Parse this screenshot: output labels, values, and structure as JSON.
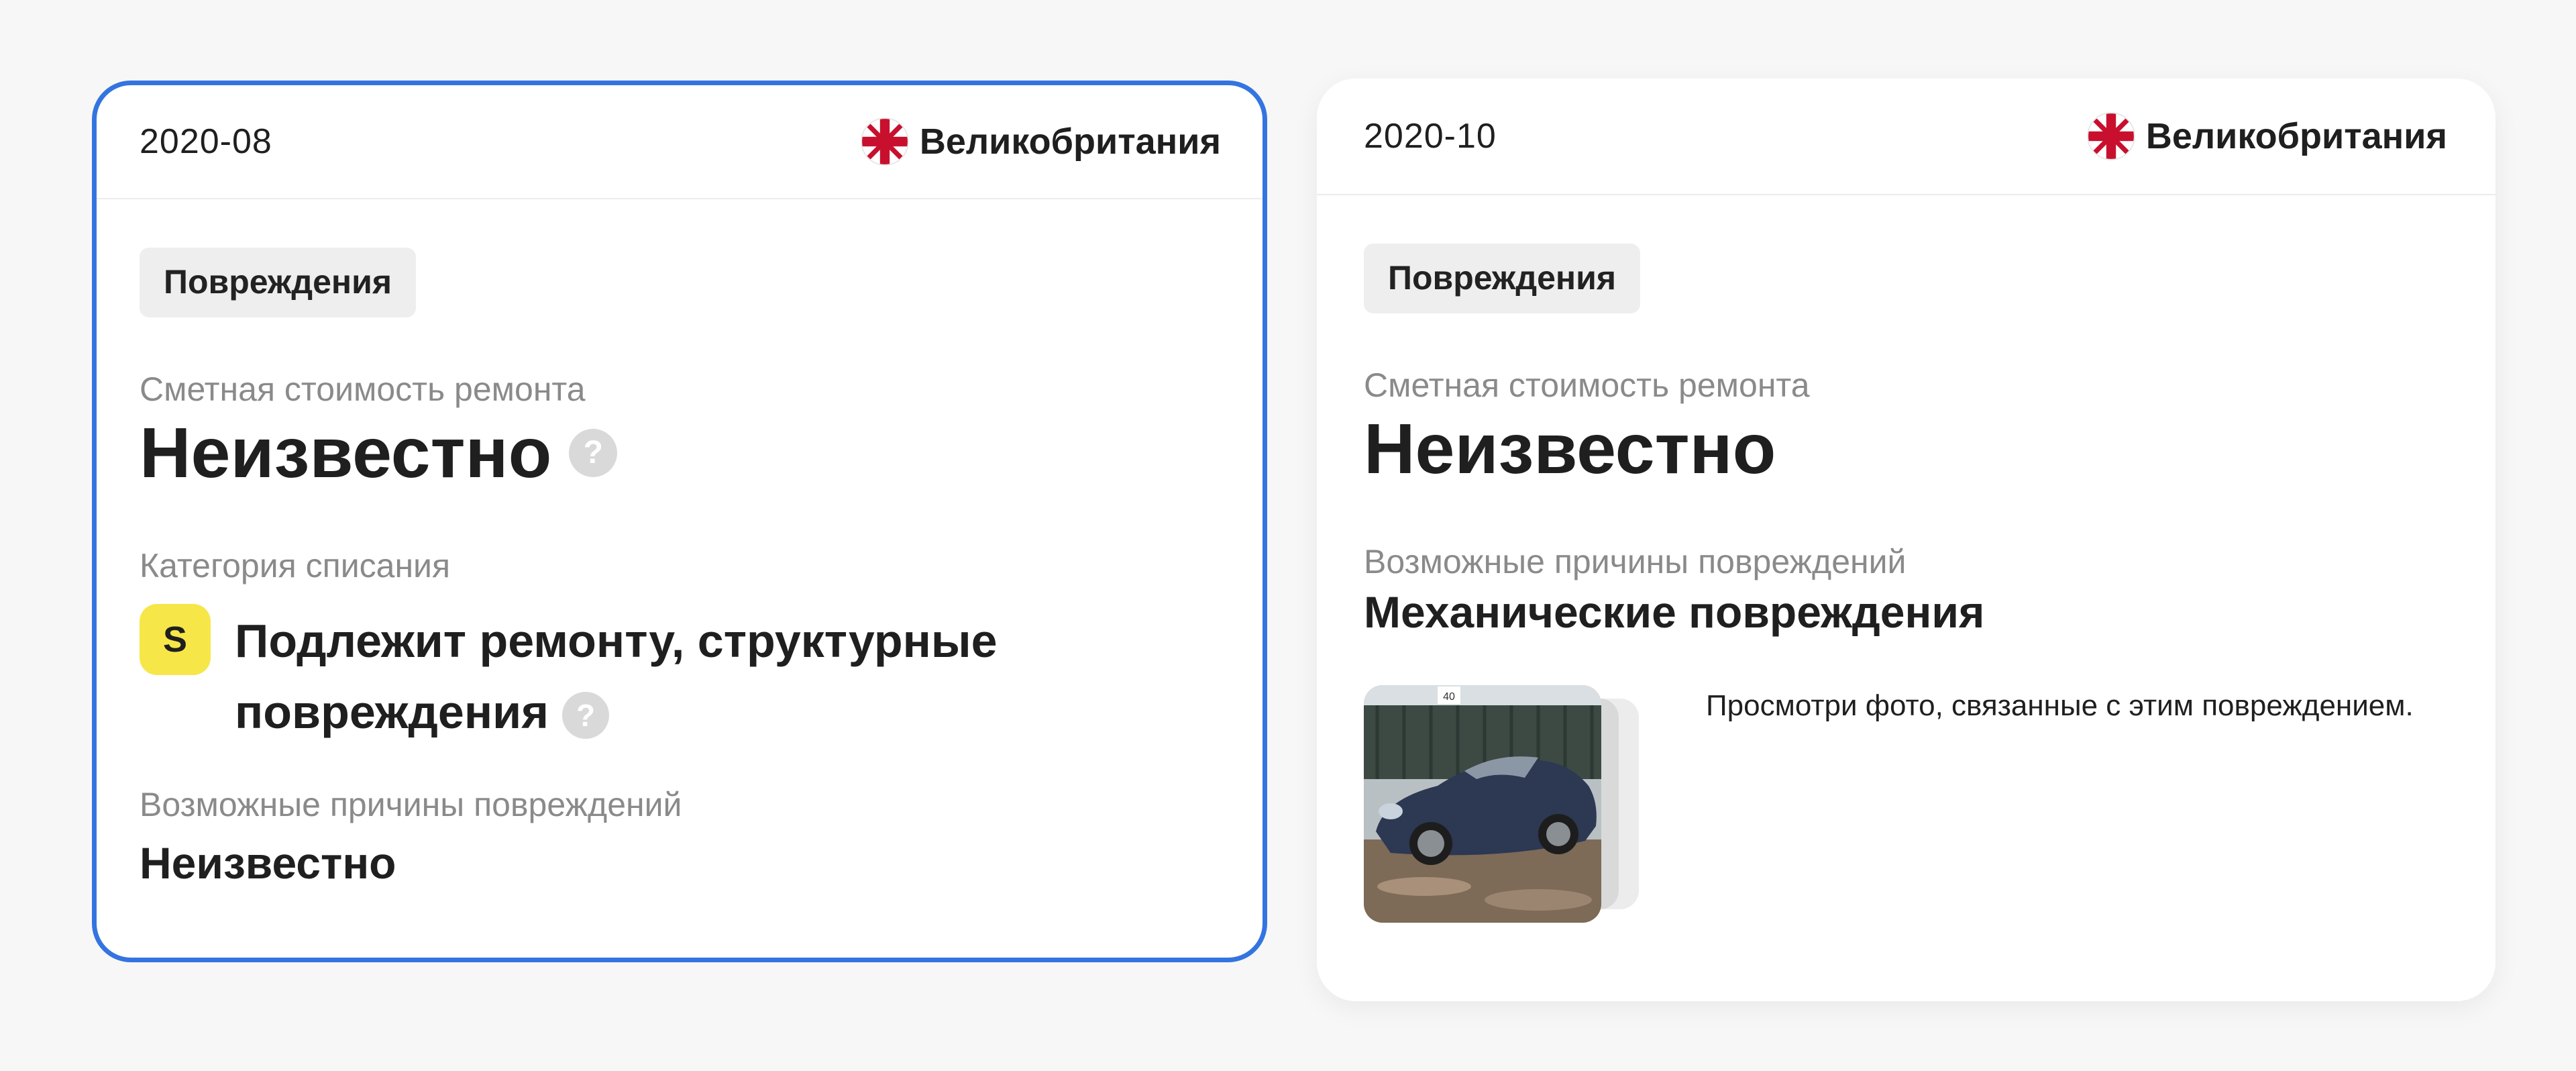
{
  "cards": [
    {
      "date": "2020-08",
      "country": "Великобритания",
      "chip": "Повреждения",
      "repair_cost_label": "Сметная стоимость ремонта",
      "repair_cost_value": "Неизвестно",
      "writeoff_label": "Категория списания",
      "writeoff_badge": "S",
      "writeoff_line1": "Подлежит ремонту, структурные",
      "writeoff_line2": "повреждения",
      "causes_label": "Возможные причины повреждений",
      "causes_value": "Неизвестно",
      "help_mark": "?"
    },
    {
      "date": "2020-10",
      "country": "Великобритания",
      "chip": "Повреждения",
      "repair_cost_label": "Сметная стоимость ремонта",
      "repair_cost_value": "Неизвестно",
      "causes_label": "Возможные причины повреждений",
      "causes_value": "Механические повреждения",
      "photos_caption": "Просмотри фото, связанные с этим повреждением.",
      "photo_sign_text": "40"
    }
  ],
  "icons": {
    "flag": "uk-flag-icon",
    "help": "question-circle-icon"
  },
  "colors": {
    "selected_border": "#3474e0",
    "badge_s": "#f7e648",
    "label_gray": "#8a8a8a",
    "chip_bg": "#eeeeee"
  }
}
